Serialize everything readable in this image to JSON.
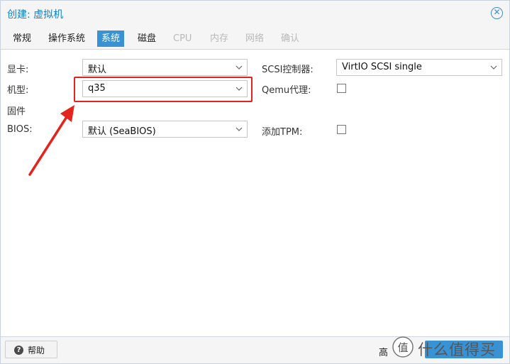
{
  "window": {
    "title": "创建: 虚拟机"
  },
  "tabs": [
    {
      "label": "常规",
      "state": "normal"
    },
    {
      "label": "操作系统",
      "state": "normal"
    },
    {
      "label": "系统",
      "state": "active"
    },
    {
      "label": "磁盘",
      "state": "normal"
    },
    {
      "label": "CPU",
      "state": "disabled"
    },
    {
      "label": "内存",
      "state": "disabled"
    },
    {
      "label": "网络",
      "state": "disabled"
    },
    {
      "label": "确认",
      "state": "disabled"
    }
  ],
  "form": {
    "graphics_label": "显卡:",
    "graphics_value": "默认",
    "machine_label": "机型:",
    "machine_value": "q35",
    "firmware_label": "固件",
    "bios_label": "BIOS:",
    "bios_value": "默认 (SeaBIOS)",
    "scsi_label": "SCSI控制器:",
    "scsi_value": "VirtIO SCSI single",
    "qemu_agent_label": "Qemu代理:",
    "qemu_agent_checked": false,
    "tpm_label": "添加TPM:",
    "tpm_checked": false
  },
  "footer": {
    "help_label": "帮助",
    "advanced_label": "高"
  },
  "watermark": {
    "text": "什么值得买"
  },
  "colors": {
    "accent": "#3892d4",
    "title": "#157fcc",
    "annotation_red": "#e3231c"
  }
}
